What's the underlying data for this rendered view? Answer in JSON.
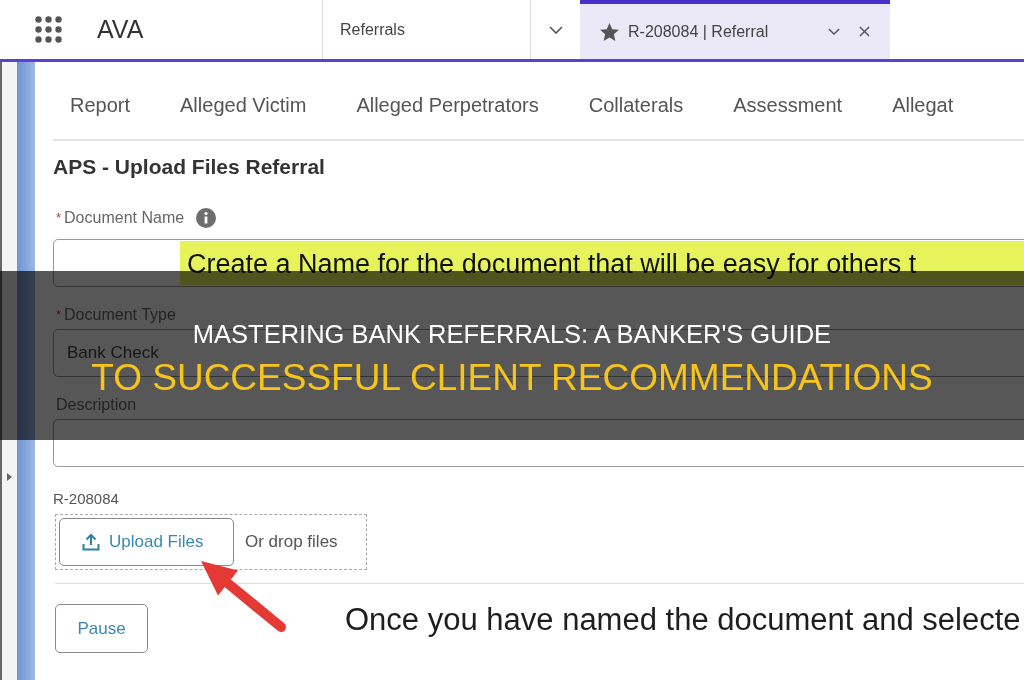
{
  "top_bar": {
    "app_name": "AVA",
    "nav_tabs": [
      {
        "kind": "menu",
        "label": "Referrals",
        "selected": false
      },
      {
        "kind": "record",
        "label": "R-208084 | Referral",
        "selected": true
      }
    ]
  },
  "record_tabs": [
    {
      "label": "Report",
      "selected": false
    },
    {
      "label": "Alleged Victim",
      "selected": false
    },
    {
      "label": "Alleged Perpetrators",
      "selected": false
    },
    {
      "label": "Collaterals",
      "selected": false
    },
    {
      "label": "Assessment",
      "selected": false
    },
    {
      "label": "Allegat",
      "selected": false
    }
  ],
  "form": {
    "title": "APS - Upload Files Referral",
    "fields": [
      {
        "kind": "text",
        "required_mark": "*",
        "label": "Document Name",
        "info": true
      },
      {
        "kind": "select",
        "required_mark": "*",
        "label": "Document Type",
        "value": "Bank Check",
        "info": false
      },
      {
        "kind": "textarea",
        "label": "Description",
        "info": false
      }
    ],
    "upload": {
      "label": "R-208084",
      "button": "Upload Files",
      "drop_hint": "Or drop files"
    },
    "buttons": [
      "Pause"
    ]
  },
  "annotations": {
    "highlight_note": "Create a Name for the document that will be easy for others t",
    "caption": "Once you have named the document and selecte"
  },
  "banner": {
    "title_lines": [
      "MASTERING BANK REFERRALS: A BANKER'S GUIDE",
      "TO SUCCESSFUL CLIENT RECOMMENDATIONS"
    ]
  }
}
